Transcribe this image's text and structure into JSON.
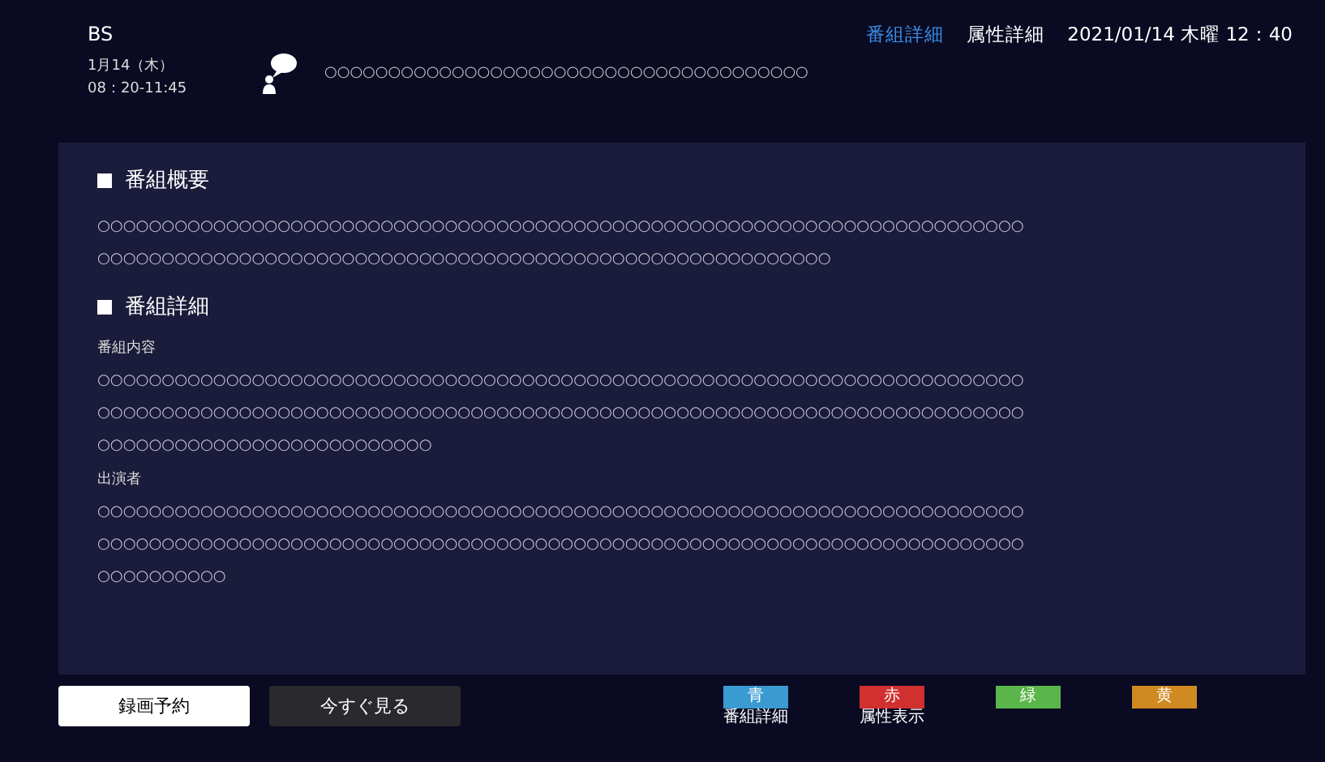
{
  "header": {
    "channel": "BS",
    "date": "1月14（木）",
    "time": "08：20-11:45",
    "title": "○○○○○○○○○○○○○○○○○○○○○○○○○○○○○○○○○○○○○○"
  },
  "tabs": [
    {
      "label": "番組詳細",
      "selected": true
    },
    {
      "label": "属性詳細",
      "selected": false
    }
  ],
  "clock": "2021/01/14 木曜 12：40",
  "sections": [
    {
      "heading": "番組概要",
      "blocks": [
        {
          "lines": [
            "○○○○○○○○○○○○○○○○○○○○○○○○○○○○○○○○○○○○○○○○○○○○○○○○○○○○○○○○○○○○○○○○○○○○○○○○",
            "○○○○○○○○○○○○○○○○○○○○○○○○○○○○○○○○○○○○○○○○○○○○○○○○○○○○○○○○○"
          ]
        }
      ]
    },
    {
      "heading": "番組詳細",
      "blocks": [
        {
          "label": "番組内容",
          "lines": [
            "○○○○○○○○○○○○○○○○○○○○○○○○○○○○○○○○○○○○○○○○○○○○○○○○○○○○○○○○○○○○○○○○○○○○○○○○",
            "○○○○○○○○○○○○○○○○○○○○○○○○○○○○○○○○○○○○○○○○○○○○○○○○○○○○○○○○○○○○○○○○○○○○○○○○",
            "○○○○○○○○○○○○○○○○○○○○○○○○○○"
          ]
        },
        {
          "label": "出演者",
          "lines": [
            "○○○○○○○○○○○○○○○○○○○○○○○○○○○○○○○○○○○○○○○○○○○○○○○○○○○○○○○○○○○○○○○○○○○○○○○○",
            "○○○○○○○○○○○○○○○○○○○○○○○○○○○○○○○○○○○○○○○○○○○○○○○○○○○○○○○○○○○○○○○○○○○○○○○○",
            "○○○○○○○○○○"
          ]
        }
      ]
    }
  ],
  "actions": [
    {
      "label": "録画予約",
      "selected": true
    },
    {
      "label": "今すぐ見る",
      "selected": false
    }
  ],
  "color_keys": [
    {
      "key": "青",
      "color": "#3a9ad2",
      "label": "番組詳細"
    },
    {
      "key": "赤",
      "color": "#d2302e",
      "label": "属性表示"
    },
    {
      "key": "緑",
      "color": "#5ab54a"
    },
    {
      "key": "黄",
      "color": "#d08a22"
    }
  ]
}
